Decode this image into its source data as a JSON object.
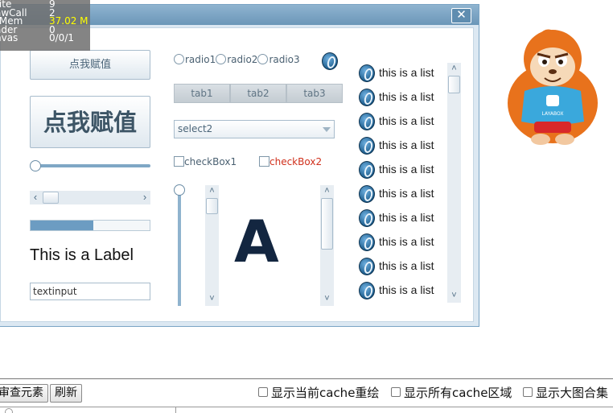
{
  "stats": [
    {
      "key": "rite",
      "value": "9"
    },
    {
      "key": "awCall",
      "value": "2"
    },
    {
      "key": "rMem",
      "value": "37.02 M"
    },
    {
      "key": "ader",
      "value": "0"
    },
    {
      "key": "nvas",
      "value": "0/0/1"
    }
  ],
  "window": {
    "close_glyph": "✕"
  },
  "buttons": {
    "small_label": "点我赋值",
    "big_label": "点我赋值"
  },
  "slider": {
    "value_fraction": 0.0
  },
  "hscroll": {
    "left_glyph": "‹",
    "right_glyph": "›"
  },
  "progress": {
    "value_percent": 53
  },
  "label": {
    "text": "This is a Label"
  },
  "textinput": {
    "value": "textinput"
  },
  "radios": [
    "radio1",
    "radio2",
    "radio3"
  ],
  "tabs": [
    "tab1",
    "tab2",
    "tab3"
  ],
  "select": {
    "selected": "select2"
  },
  "checkboxes": [
    {
      "label": "checkBox1",
      "color": "#4b6172"
    },
    {
      "label": "checkBox2",
      "color": "#d0301c"
    }
  ],
  "vscroll": {
    "up_glyph": "˄",
    "down_glyph": "˅"
  },
  "panel": {
    "letter": "A"
  },
  "list": {
    "items": [
      "this is a list",
      "this is a list",
      "this is a list",
      "this is a list",
      "this is a list",
      "this is a list",
      "this is a list",
      "this is a list",
      "this is a list",
      "this is a list"
    ]
  },
  "mascot": {
    "brand_text": "LAYABOX",
    "shirt_color": "#3aa8dc",
    "fur_color": "#e8721c"
  },
  "devbar": {
    "inspect_button": "审查元素",
    "refresh_button": "刷新",
    "check_cache_redraw": "显示当前cache重绘",
    "check_cache_regions": "显示所有cache区域",
    "check_atlas": "显示大图合集"
  }
}
